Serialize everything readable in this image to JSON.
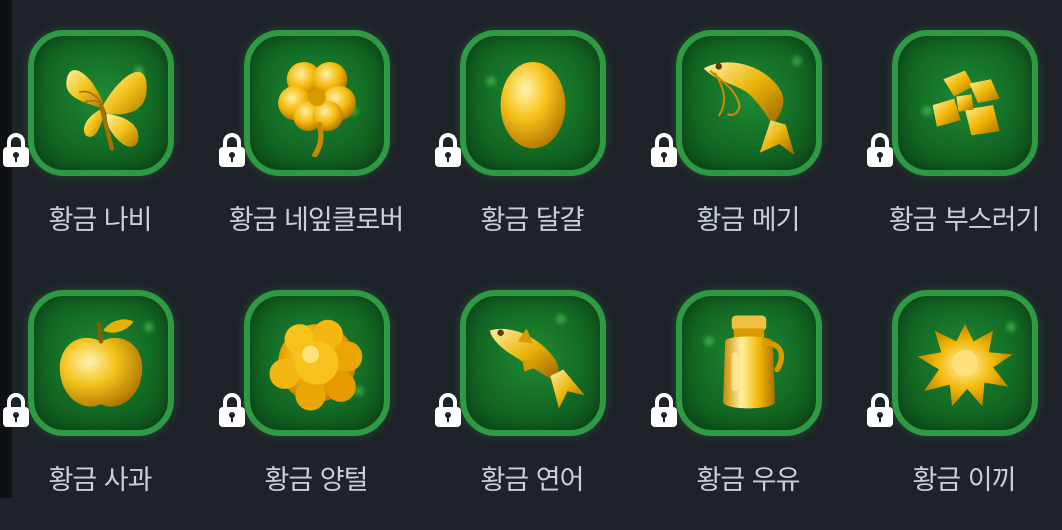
{
  "items": [
    {
      "label": "황금 나비",
      "icon": "golden-butterfly-icon",
      "locked": true
    },
    {
      "label": "황금 네잎클로버",
      "icon": "golden-four-leaf-clover-icon",
      "locked": true
    },
    {
      "label": "황금 달걀",
      "icon": "golden-egg-icon",
      "locked": true
    },
    {
      "label": "황금 메기",
      "icon": "golden-catfish-icon",
      "locked": true
    },
    {
      "label": "황금 부스러기",
      "icon": "golden-crumbs-icon",
      "locked": true
    },
    {
      "label": "황금 사과",
      "icon": "golden-apple-icon",
      "locked": true
    },
    {
      "label": "황금 양털",
      "icon": "golden-fleece-icon",
      "locked": true
    },
    {
      "label": "황금 연어",
      "icon": "golden-salmon-icon",
      "locked": true
    },
    {
      "label": "황금 우유",
      "icon": "golden-milk-jar-icon",
      "locked": true
    },
    {
      "label": "황금 이끼",
      "icon": "golden-moss-icon",
      "locked": true
    }
  ],
  "colors": {
    "background": "#1e2229",
    "tile_border": "#2f9a44",
    "tile_fill": "#136a24",
    "gold": "#f2b705",
    "label": "#c9d1d6",
    "lock": "#ffffff"
  }
}
